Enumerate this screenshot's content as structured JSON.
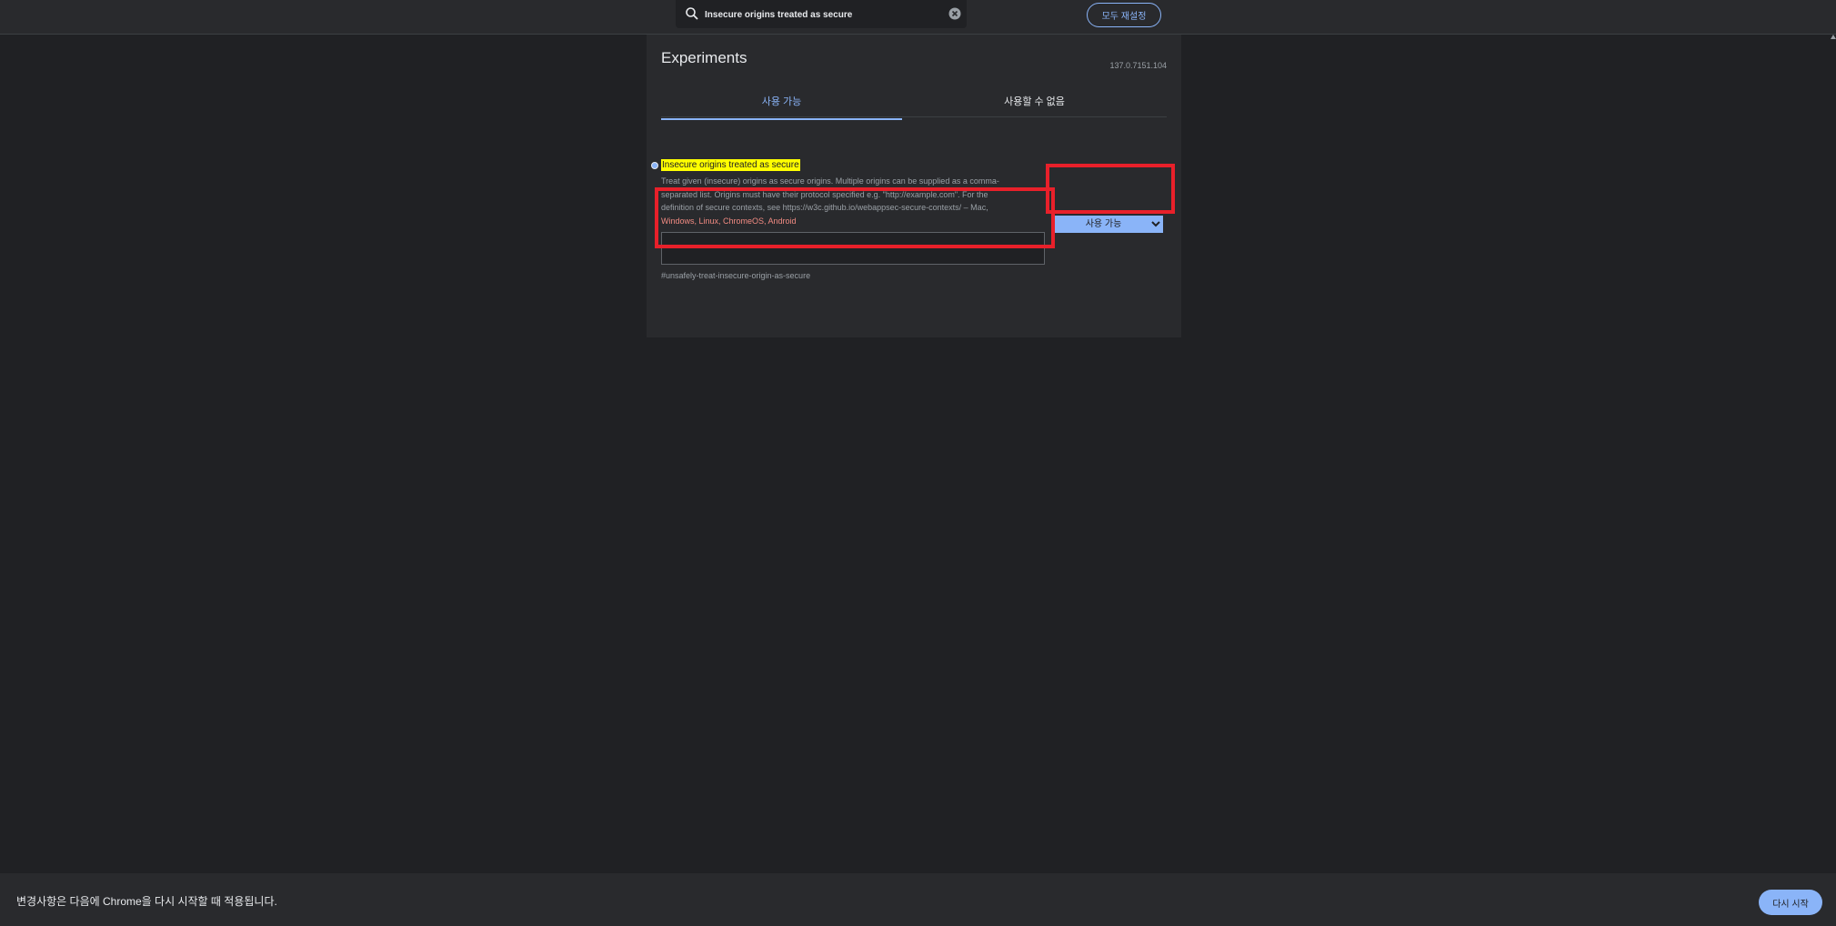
{
  "search": {
    "value": "Insecure origins treated as secure",
    "placeholder": "Search flags"
  },
  "header": {
    "reset_all_label": "모두 재설정"
  },
  "page": {
    "title": "Experiments",
    "version": "137.0.7151.104",
    "tabs": [
      {
        "label": "사용 가능",
        "active": true
      },
      {
        "label": "사용할 수 없음",
        "active": false
      }
    ]
  },
  "flag": {
    "name": "Insecure origins treated as secure",
    "description_line1": "Treat given (insecure) origins as secure origins. Multiple origins can be supplied as a comma-",
    "description_line2": "separated list. Origins must have their protocol specified e.g. \"http://example.com\". For the",
    "description_line3": "definition of secure contexts, see https://w3c.github.io/webappsec-secure-contexts/ – Mac,",
    "platforms": "Windows, Linux, ChromeOS, Android",
    "textarea_value": "",
    "anchor": "#unsafely-treat-insecure-origin-as-secure",
    "selected_option": "사용 가능"
  },
  "footer": {
    "message": "변경사항은 다음에 Chrome을 다시 시작할 때 적용됩니다.",
    "relaunch_label": "다시 시작"
  },
  "colors": {
    "accent": "#8ab4f8",
    "highlight_box": "#e8202a",
    "search_match": "#ffff00",
    "background": "#202124"
  }
}
